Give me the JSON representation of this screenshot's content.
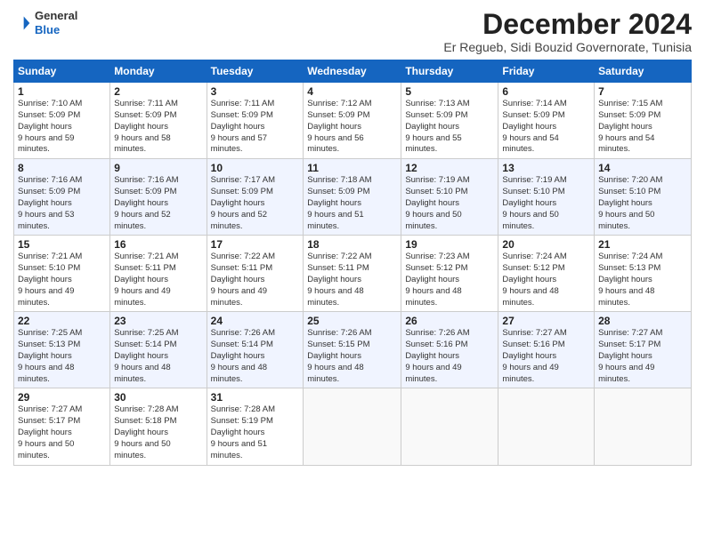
{
  "logo": {
    "general": "General",
    "blue": "Blue"
  },
  "header": {
    "month": "December 2024",
    "location": "Er Regueb, Sidi Bouzid Governorate, Tunisia"
  },
  "weekdays": [
    "Sunday",
    "Monday",
    "Tuesday",
    "Wednesday",
    "Thursday",
    "Friday",
    "Saturday"
  ],
  "weeks": [
    [
      {
        "day": "1",
        "sunrise": "7:10 AM",
        "sunset": "5:09 PM",
        "daylight": "9 hours and 59 minutes."
      },
      {
        "day": "2",
        "sunrise": "7:11 AM",
        "sunset": "5:09 PM",
        "daylight": "9 hours and 58 minutes."
      },
      {
        "day": "3",
        "sunrise": "7:11 AM",
        "sunset": "5:09 PM",
        "daylight": "9 hours and 57 minutes."
      },
      {
        "day": "4",
        "sunrise": "7:12 AM",
        "sunset": "5:09 PM",
        "daylight": "9 hours and 56 minutes."
      },
      {
        "day": "5",
        "sunrise": "7:13 AM",
        "sunset": "5:09 PM",
        "daylight": "9 hours and 55 minutes."
      },
      {
        "day": "6",
        "sunrise": "7:14 AM",
        "sunset": "5:09 PM",
        "daylight": "9 hours and 54 minutes."
      },
      {
        "day": "7",
        "sunrise": "7:15 AM",
        "sunset": "5:09 PM",
        "daylight": "9 hours and 54 minutes."
      }
    ],
    [
      {
        "day": "8",
        "sunrise": "7:16 AM",
        "sunset": "5:09 PM",
        "daylight": "9 hours and 53 minutes."
      },
      {
        "day": "9",
        "sunrise": "7:16 AM",
        "sunset": "5:09 PM",
        "daylight": "9 hours and 52 minutes."
      },
      {
        "day": "10",
        "sunrise": "7:17 AM",
        "sunset": "5:09 PM",
        "daylight": "9 hours and 52 minutes."
      },
      {
        "day": "11",
        "sunrise": "7:18 AM",
        "sunset": "5:09 PM",
        "daylight": "9 hours and 51 minutes."
      },
      {
        "day": "12",
        "sunrise": "7:19 AM",
        "sunset": "5:10 PM",
        "daylight": "9 hours and 50 minutes."
      },
      {
        "day": "13",
        "sunrise": "7:19 AM",
        "sunset": "5:10 PM",
        "daylight": "9 hours and 50 minutes."
      },
      {
        "day": "14",
        "sunrise": "7:20 AM",
        "sunset": "5:10 PM",
        "daylight": "9 hours and 50 minutes."
      }
    ],
    [
      {
        "day": "15",
        "sunrise": "7:21 AM",
        "sunset": "5:10 PM",
        "daylight": "9 hours and 49 minutes."
      },
      {
        "day": "16",
        "sunrise": "7:21 AM",
        "sunset": "5:11 PM",
        "daylight": "9 hours and 49 minutes."
      },
      {
        "day": "17",
        "sunrise": "7:22 AM",
        "sunset": "5:11 PM",
        "daylight": "9 hours and 49 minutes."
      },
      {
        "day": "18",
        "sunrise": "7:22 AM",
        "sunset": "5:11 PM",
        "daylight": "9 hours and 48 minutes."
      },
      {
        "day": "19",
        "sunrise": "7:23 AM",
        "sunset": "5:12 PM",
        "daylight": "9 hours and 48 minutes."
      },
      {
        "day": "20",
        "sunrise": "7:24 AM",
        "sunset": "5:12 PM",
        "daylight": "9 hours and 48 minutes."
      },
      {
        "day": "21",
        "sunrise": "7:24 AM",
        "sunset": "5:13 PM",
        "daylight": "9 hours and 48 minutes."
      }
    ],
    [
      {
        "day": "22",
        "sunrise": "7:25 AM",
        "sunset": "5:13 PM",
        "daylight": "9 hours and 48 minutes."
      },
      {
        "day": "23",
        "sunrise": "7:25 AM",
        "sunset": "5:14 PM",
        "daylight": "9 hours and 48 minutes."
      },
      {
        "day": "24",
        "sunrise": "7:26 AM",
        "sunset": "5:14 PM",
        "daylight": "9 hours and 48 minutes."
      },
      {
        "day": "25",
        "sunrise": "7:26 AM",
        "sunset": "5:15 PM",
        "daylight": "9 hours and 48 minutes."
      },
      {
        "day": "26",
        "sunrise": "7:26 AM",
        "sunset": "5:16 PM",
        "daylight": "9 hours and 49 minutes."
      },
      {
        "day": "27",
        "sunrise": "7:27 AM",
        "sunset": "5:16 PM",
        "daylight": "9 hours and 49 minutes."
      },
      {
        "day": "28",
        "sunrise": "7:27 AM",
        "sunset": "5:17 PM",
        "daylight": "9 hours and 49 minutes."
      }
    ],
    [
      {
        "day": "29",
        "sunrise": "7:27 AM",
        "sunset": "5:17 PM",
        "daylight": "9 hours and 50 minutes."
      },
      {
        "day": "30",
        "sunrise": "7:28 AM",
        "sunset": "5:18 PM",
        "daylight": "9 hours and 50 minutes."
      },
      {
        "day": "31",
        "sunrise": "7:28 AM",
        "sunset": "5:19 PM",
        "daylight": "9 hours and 51 minutes."
      },
      null,
      null,
      null,
      null
    ]
  ]
}
